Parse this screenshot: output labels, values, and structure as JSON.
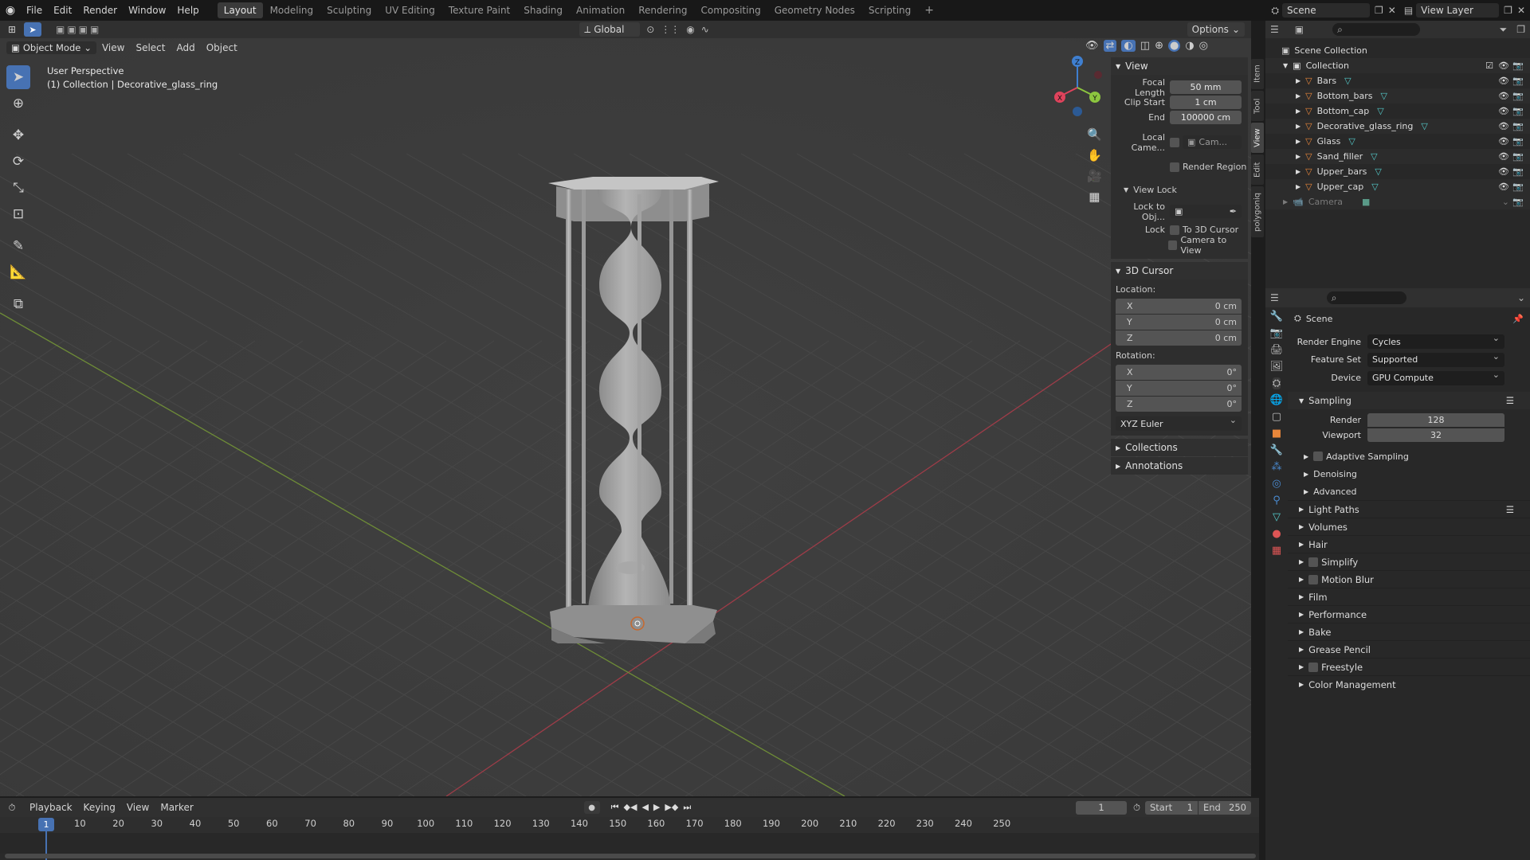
{
  "topbar": {
    "menus": [
      "File",
      "Edit",
      "Render",
      "Window",
      "Help"
    ],
    "workspaces": [
      "Layout",
      "Modeling",
      "Sculpting",
      "UV Editing",
      "Texture Paint",
      "Shading",
      "Animation",
      "Rendering",
      "Compositing",
      "Geometry Nodes",
      "Scripting"
    ],
    "active_workspace": "Layout",
    "add_tab": "+",
    "scene": "Scene",
    "view_layer": "View Layer"
  },
  "viewport_header": {
    "mode": "Object Mode",
    "menus": [
      "View",
      "Select",
      "Add",
      "Object"
    ],
    "orientation": "Global",
    "options": "Options"
  },
  "overlay": {
    "line1": "User Perspective",
    "line2": "(1) Collection | Decorative_glass_ring"
  },
  "gizmo": {
    "x": "X",
    "y": "Y",
    "z": "Z"
  },
  "side_tabs": [
    "Item",
    "Tool",
    "View",
    "Edit",
    "polygoniq"
  ],
  "npanel": {
    "view_title": "View",
    "focal_length_label": "Focal Length",
    "focal_length": "50 mm",
    "clip_start_label": "Clip Start",
    "clip_start": "1 cm",
    "end_label": "End",
    "end": "100000 cm",
    "local_camera_label": "Local Came...",
    "local_camera_value": "Cam...",
    "render_region": "Render Region",
    "view_lock_title": "View Lock",
    "lock_to_obj_label": "Lock to Obj...",
    "lock_label": "Lock",
    "to_3d_cursor": "To 3D Cursor",
    "camera_to_view": "Camera to View",
    "cursor_title": "3D Cursor",
    "location_label": "Location:",
    "loc": [
      {
        "axis": "X",
        "value": "0 cm"
      },
      {
        "axis": "Y",
        "value": "0 cm"
      },
      {
        "axis": "Z",
        "value": "0 cm"
      }
    ],
    "rotation_label": "Rotation:",
    "rot": [
      {
        "axis": "X",
        "value": "0°"
      },
      {
        "axis": "Y",
        "value": "0°"
      },
      {
        "axis": "Z",
        "value": "0°"
      }
    ],
    "rotation_mode": "XYZ Euler",
    "collections": "Collections",
    "annotations": "Annotations"
  },
  "outliner": {
    "root": "Scene Collection",
    "collection": "Collection",
    "objects": [
      "Bars",
      "Bottom_bars",
      "Bottom_cap",
      "Decorative_glass_ring",
      "Glass",
      "Sand_filler",
      "Upper_bars",
      "Upper_cap"
    ],
    "camera": "Camera"
  },
  "properties": {
    "context": "Scene",
    "render_engine_label": "Render Engine",
    "render_engine": "Cycles",
    "feature_set_label": "Feature Set",
    "feature_set": "Supported",
    "device_label": "Device",
    "device": "GPU Compute",
    "sampling": "Sampling",
    "render_label": "Render",
    "render_samples": "128",
    "viewport_label": "Viewport",
    "viewport_samples": "32",
    "adaptive": "Adaptive Sampling",
    "denoising": "Denoising",
    "advanced": "Advanced",
    "sections": [
      "Light Paths",
      "Volumes",
      "Hair",
      "Simplify",
      "Motion Blur",
      "Film",
      "Performance",
      "Bake",
      "Grease Pencil",
      "Freestyle",
      "Color Management"
    ]
  },
  "timeline": {
    "menus": [
      "Playback",
      "Keying",
      "View",
      "Marker"
    ],
    "current_frame": "1",
    "start_label": "Start",
    "start": "1",
    "end_label": "End",
    "end": "250",
    "ticks": [
      "1",
      "10",
      "20",
      "30",
      "40",
      "50",
      "60",
      "70",
      "80",
      "90",
      "100",
      "110",
      "120",
      "130",
      "140",
      "150",
      "160",
      "170",
      "180",
      "190",
      "200",
      "210",
      "220",
      "230",
      "240",
      "250"
    ]
  },
  "colors": {
    "accent": "#4772b3",
    "viewport": "#3d3d3d",
    "x_axis": "#e0435c",
    "y_axis": "#8cc63f",
    "z_axis": "#3f7fd0",
    "object": "#e8863a"
  }
}
